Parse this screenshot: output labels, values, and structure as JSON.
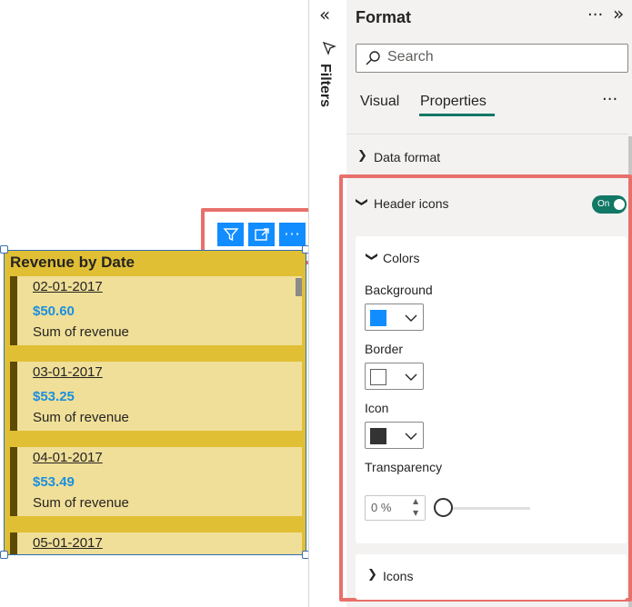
{
  "visual": {
    "title": "Revenue by Date",
    "cards": [
      {
        "date": "02-01-2017",
        "value": "$50.60",
        "label": "Sum of revenue"
      },
      {
        "date": "03-01-2017",
        "value": "$53.25",
        "label": "Sum of revenue"
      },
      {
        "date": "04-01-2017",
        "value": "$53.49",
        "label": "Sum of revenue"
      },
      {
        "date": "05-01-2017",
        "value": "",
        "label": ""
      }
    ],
    "header_buttons": [
      "filter-icon",
      "focus-mode-icon",
      "more-options-icon"
    ]
  },
  "filters": {
    "label": "Filters"
  },
  "format_pane": {
    "title": "Format",
    "search_placeholder": "Search",
    "tabs": [
      "Visual",
      "Properties"
    ],
    "active_tab": "Properties",
    "sections": {
      "data_format": "Data format",
      "header_icons": "Header icons",
      "header_icons_toggle": "On",
      "colors": "Colors",
      "background_label": "Background",
      "border_label": "Border",
      "icon_label": "Icon",
      "transparency_label": "Transparency",
      "transparency_value": "0 %",
      "transparency_percent": 0,
      "icons": "Icons"
    },
    "swatches": {
      "background": "#118dff",
      "border": "#ffffff",
      "icon": "#333333"
    }
  },
  "colors": {
    "accent": "#117865",
    "visual_bg": "#e1bf35",
    "highlight": "#e8706b"
  }
}
